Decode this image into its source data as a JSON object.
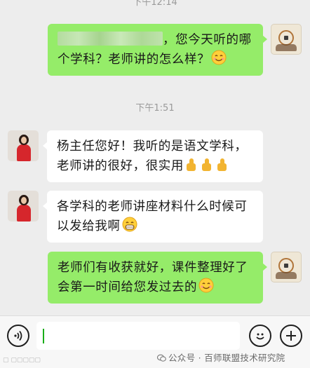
{
  "timestamps": {
    "top": "下午12:14",
    "middle": "下午1:51"
  },
  "messages": [
    {
      "sender": "self",
      "text_after_blur": "，您今天听的哪个学科？老师讲的怎么样？",
      "emoji": "smile-emoji"
    },
    {
      "sender": "other",
      "text": "杨主任您好！我听的是语文学科，老师讲的很好，很实用",
      "emoji": "thumbs-up-emoji ×3"
    },
    {
      "sender": "other",
      "text": "各学科的老师讲座材料什么时候可以发给我啊",
      "emoji": "grin-emoji"
    },
    {
      "sender": "self",
      "text": "老师们有收获就好，课件整理好了会第一时间给您发过去的",
      "emoji": "smile-emoji"
    }
  ],
  "input_bar": {
    "value": ""
  },
  "footer": {
    "text": "公众号 · 百师联盟技术研究院"
  },
  "colors": {
    "outgoing": "#95ec69",
    "incoming": "#ffffff",
    "background": "#ededed",
    "caret": "#1aad19"
  }
}
